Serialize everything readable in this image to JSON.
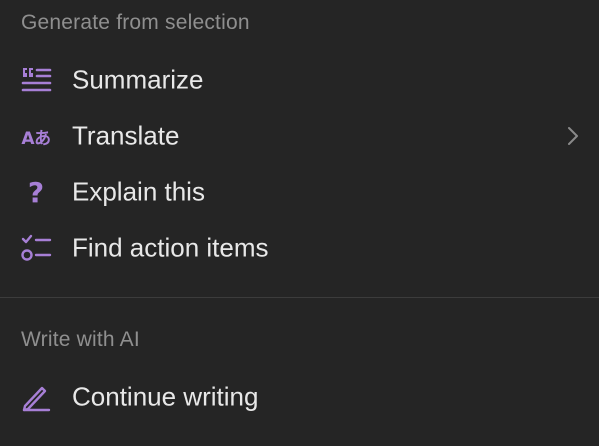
{
  "colors": {
    "background": "#252525",
    "accent": "#a77fd6",
    "header_text": "#8f8f8f",
    "item_text": "#e8e8e8",
    "divider": "#3c3c3c"
  },
  "sections": [
    {
      "header": "Generate from selection",
      "items": [
        {
          "label": "Summarize",
          "icon": "quote-lines-icon",
          "has_submenu": false
        },
        {
          "label": "Translate",
          "icon": "translate-icon",
          "icon_text": "Aあ",
          "has_submenu": true
        },
        {
          "label": "Explain this",
          "icon": "question-mark-icon",
          "icon_text": "?",
          "has_submenu": false
        },
        {
          "label": "Find action items",
          "icon": "checklist-icon",
          "has_submenu": false
        }
      ]
    },
    {
      "header": "Write with AI",
      "items": [
        {
          "label": "Continue writing",
          "icon": "pen-icon",
          "has_submenu": false
        }
      ]
    }
  ]
}
